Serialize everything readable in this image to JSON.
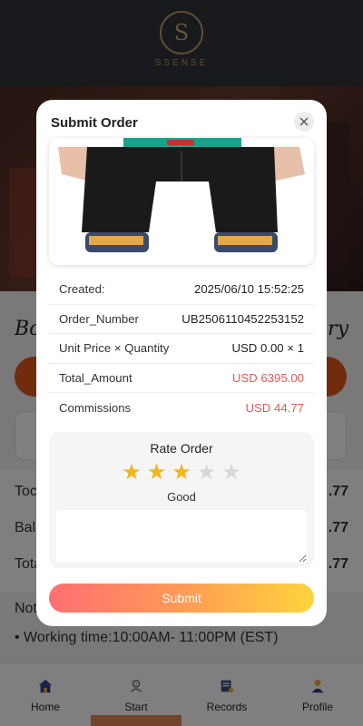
{
  "brand": {
    "letter": "S",
    "name": "SSENSE"
  },
  "background": {
    "headline_left": "Bo",
    "headline_right": "ry",
    "stats": [
      {
        "label": "Toc",
        "value": ".77"
      },
      {
        "label": "Bal",
        "value": ".77"
      },
      {
        "label": "Tota",
        "value": ".77"
      }
    ],
    "notes_title": "Not",
    "notes_item": "• Working time:10:00AM- 11:00PM (EST)"
  },
  "nav": [
    {
      "label": "Home",
      "icon": "home-icon"
    },
    {
      "label": "Start",
      "icon": "start-icon",
      "active": true
    },
    {
      "label": "Records",
      "icon": "records-icon"
    },
    {
      "label": "Profile",
      "icon": "profile-icon"
    }
  ],
  "modal": {
    "title": "Submit Order",
    "close_icon": "close-icon",
    "rows": [
      {
        "label": "Created:",
        "value": "2025/06/10 15:52:25"
      },
      {
        "label": "Order_Number",
        "value": "UB2506110452253152"
      },
      {
        "label": "Unit Price × Quantity",
        "value": "USD 0.00 × 1"
      },
      {
        "label": "Total_Amount",
        "value": "USD 6395.00"
      },
      {
        "label": "Commissions",
        "value": "USD 44.77"
      }
    ],
    "rate": {
      "title": "Rate Order",
      "stars_selected": 3,
      "stars_total": 5,
      "label": "Good",
      "comment": ""
    },
    "submit_label": "Submit"
  },
  "colors": {
    "accent_orange": "#e2561b",
    "amount_red": "#e05b55",
    "star_gold": "#f5b418",
    "brand_gold": "#b89a6a"
  }
}
